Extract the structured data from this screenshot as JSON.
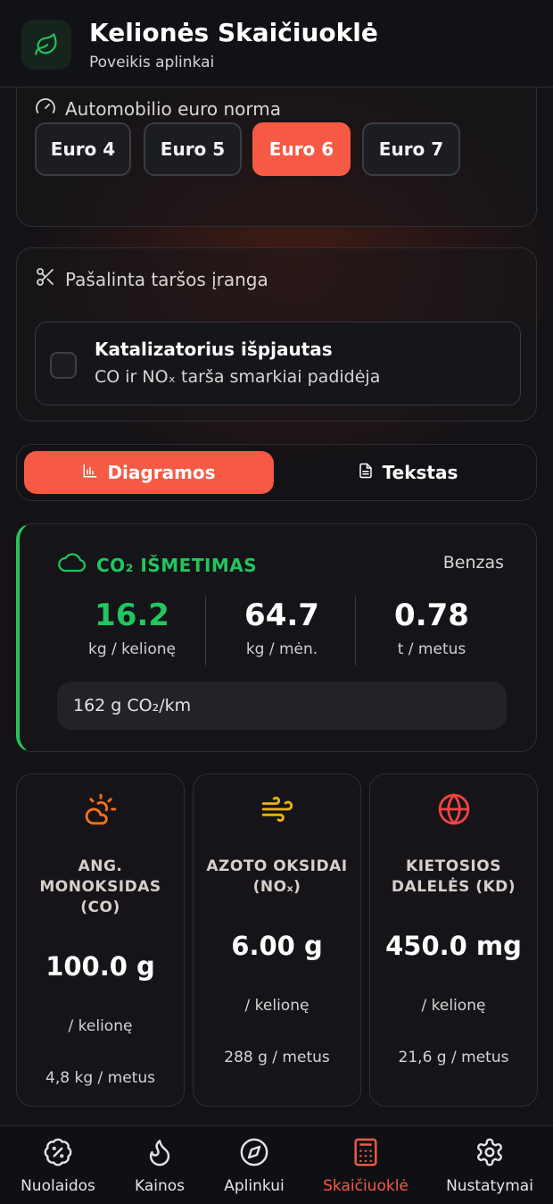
{
  "header": {
    "title": "Kelionės Skaičiuoklė",
    "subtitle": "Poveikis aplinkai",
    "logo_icon": "leaf-icon"
  },
  "euro_section": {
    "label": "Automobilio euro norma",
    "icon": "gauge-icon",
    "options": [
      "Euro 4",
      "Euro 5",
      "Euro 6",
      "Euro 7"
    ],
    "selected": "Euro 6"
  },
  "removed_equipment": {
    "label": "Pašalinta taršos įranga",
    "icon": "scissors-icon",
    "catalyst": {
      "title": "Katalizatorius išpjautas",
      "description": "CO ir NOₓ tarša smarkiai padidėja",
      "checked": false
    }
  },
  "view_toggle": {
    "charts": "Diagramos",
    "text": "Tekstas",
    "active": "Diagramos"
  },
  "co2": {
    "title": "CO₂ IŠMETIMAS",
    "fuel": "Benzas",
    "per_trip": "16.2",
    "per_trip_unit": "kg / kelionę",
    "per_month": "64.7",
    "per_month_unit": "kg / mėn.",
    "per_year": "0.78",
    "per_year_unit": "t / metus",
    "per_km": "162 g CO₂/km"
  },
  "pollutants": [
    {
      "name": "ANG. MONOKSIDAS (CO)",
      "value": "100.0 g",
      "unit": "/ kelionę",
      "yearly": "4,8 kg / metus",
      "icon": "cloud-sun-icon",
      "color": "#f97316"
    },
    {
      "name": "AZOTO OKSIDAI (NOₓ)",
      "value": "6.00 g",
      "unit": "/ kelionę",
      "yearly": "288 g / metus",
      "icon": "wind-icon",
      "color": "#eab308"
    },
    {
      "name": "KIETOSIOS DALELĖS (KD)",
      "value": "450.0 mg",
      "unit": "/ kelionę",
      "yearly": "21,6 g / metus",
      "icon": "globe-icon",
      "color": "#ef4444"
    }
  ],
  "nav": {
    "items": [
      {
        "label": "Nuolaidos",
        "icon": "discount-icon"
      },
      {
        "label": "Kainos",
        "icon": "flame-icon"
      },
      {
        "label": "Aplinkui",
        "icon": "compass-icon"
      },
      {
        "label": "Skaičiuoklė",
        "icon": "calculator-icon"
      },
      {
        "label": "Nustatymai",
        "icon": "settings-icon"
      }
    ],
    "active": "Skaičiuoklė"
  },
  "colors": {
    "accent": "#f65a45",
    "green": "#22c55e",
    "background": "#141216"
  }
}
